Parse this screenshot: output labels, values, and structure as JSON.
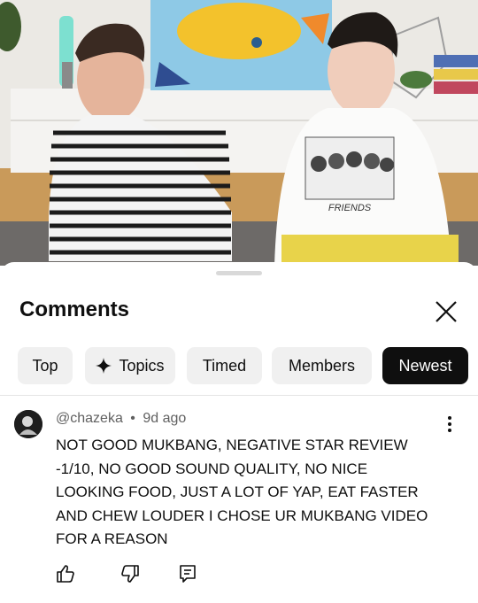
{
  "sheet": {
    "title": "Comments",
    "chips": [
      {
        "label": "Top",
        "active": false
      },
      {
        "label": "Topics",
        "icon": "sparkle-icon",
        "active": false
      },
      {
        "label": "Timed",
        "active": false
      },
      {
        "label": "Members",
        "active": false
      },
      {
        "label": "Newest",
        "active": true
      }
    ]
  },
  "video": {
    "shirt_text": "FRIENDS"
  },
  "comment": {
    "author": "@chazeka",
    "separator": "•",
    "time": "9d ago",
    "lines": [
      "NOT GOOD MUKBANG, NEGATIVE STAR REVIEW",
      "-1/10, NO GOOD SOUND QUALITY, NO NICE",
      "LOOKING FOOD, JUST A LOT OF YAP, EAT FASTER",
      "AND CHEW LOUDER I CHOSE UR MUKBANG VIDEO",
      "FOR A REASON"
    ],
    "actions": [
      "like-icon",
      "dislike-icon",
      "reply-icon"
    ]
  },
  "colors": {
    "text_primary": "#0f0f0f",
    "text_secondary": "#606060",
    "chip_bg": "#f0f0f0",
    "chip_active_bg": "#0f0f0f"
  }
}
